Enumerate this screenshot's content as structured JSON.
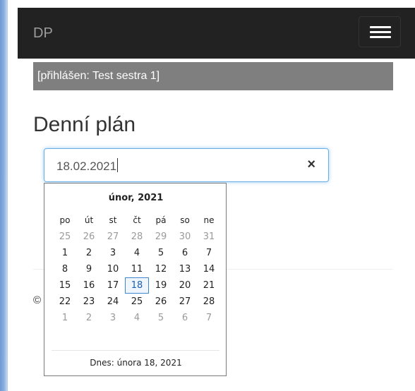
{
  "navbar": {
    "brand": "DP",
    "toggle_icon": "hamburger-menu-icon"
  },
  "login_status": "[přihlášen: Test sestra 1]",
  "page_title": "Denní plán",
  "date_field": {
    "value": "18.02.2021",
    "clear_label": "×"
  },
  "calendar": {
    "month_label": "únor, 2021",
    "weekdays": [
      "po",
      "út",
      "st",
      "čt",
      "pá",
      "so",
      "ne"
    ],
    "weeks": [
      [
        {
          "d": "25",
          "m": true
        },
        {
          "d": "26",
          "m": true
        },
        {
          "d": "27",
          "m": true
        },
        {
          "d": "28",
          "m": true
        },
        {
          "d": "29",
          "m": true
        },
        {
          "d": "30",
          "m": true
        },
        {
          "d": "31",
          "m": true
        }
      ],
      [
        {
          "d": "1"
        },
        {
          "d": "2"
        },
        {
          "d": "3"
        },
        {
          "d": "4"
        },
        {
          "d": "5"
        },
        {
          "d": "6"
        },
        {
          "d": "7"
        }
      ],
      [
        {
          "d": "8"
        },
        {
          "d": "9"
        },
        {
          "d": "10"
        },
        {
          "d": "11"
        },
        {
          "d": "12"
        },
        {
          "d": "13"
        },
        {
          "d": "14"
        }
      ],
      [
        {
          "d": "15"
        },
        {
          "d": "16"
        },
        {
          "d": "17"
        },
        {
          "d": "18",
          "t": true
        },
        {
          "d": "19"
        },
        {
          "d": "20"
        },
        {
          "d": "21"
        }
      ],
      [
        {
          "d": "22"
        },
        {
          "d": "23"
        },
        {
          "d": "24"
        },
        {
          "d": "25"
        },
        {
          "d": "26"
        },
        {
          "d": "27"
        },
        {
          "d": "28"
        }
      ],
      [
        {
          "d": "1",
          "m": true
        },
        {
          "d": "2",
          "m": true
        },
        {
          "d": "3",
          "m": true
        },
        {
          "d": "4",
          "m": true
        },
        {
          "d": "5",
          "m": true
        },
        {
          "d": "6",
          "m": true
        },
        {
          "d": "7",
          "m": true
        }
      ]
    ],
    "today_label": "Dnes: února 18, 2021"
  },
  "footer": {
    "copyright": "©"
  },
  "colors": {
    "navbar": "#222222",
    "login_bar": "#7f7f7f",
    "focus": "#66afe9",
    "today": "#3d87d0"
  }
}
